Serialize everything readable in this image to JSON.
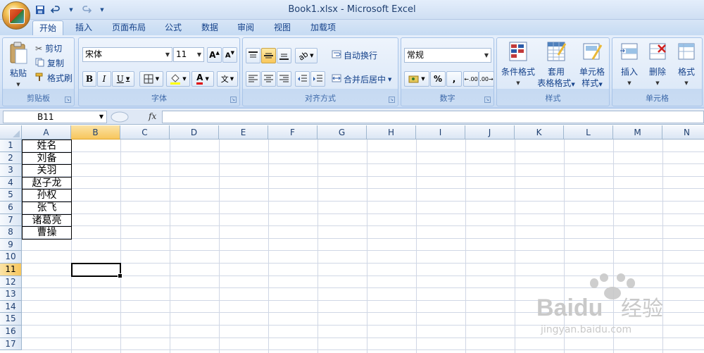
{
  "window": {
    "title": "Book1.xlsx - Microsoft Excel"
  },
  "tabs": [
    "开始",
    "插入",
    "页面布局",
    "公式",
    "数据",
    "审阅",
    "视图",
    "加载项"
  ],
  "active_tab": "开始",
  "clipboard": {
    "paste": "粘贴",
    "cut": "剪切",
    "copy": "复制",
    "format_painter": "格式刷",
    "group": "剪贴板"
  },
  "font": {
    "name": "宋体",
    "size": "11",
    "bold": "B",
    "italic": "I",
    "underline": "U",
    "group": "字体",
    "phonetic": "文"
  },
  "alignment": {
    "wrap": "自动换行",
    "merge": "合并后居中",
    "group": "对齐方式"
  },
  "number": {
    "format": "常规",
    "percent": "%",
    "comma": ",",
    "inc_decimal": ".00",
    "dec_decimal": ".00",
    "group": "数字"
  },
  "styles": {
    "conditional": "条件格式",
    "table_a": "套用",
    "table_b": "表格格式",
    "cell_a": "单元格",
    "cell_b": "样式",
    "group": "样式"
  },
  "cells": {
    "insert": "插入",
    "delete": "删除",
    "format": "格式",
    "group": "单元格"
  },
  "formula_bar": {
    "name_box": "B11",
    "fx": "fx",
    "value": ""
  },
  "columns": [
    "A",
    "B",
    "C",
    "D",
    "E",
    "F",
    "G",
    "H",
    "I",
    "J",
    "K",
    "L",
    "M",
    "N"
  ],
  "selected_column": "B",
  "rows": [
    "1",
    "2",
    "3",
    "4",
    "5",
    "6",
    "7",
    "8",
    "9",
    "10",
    "11",
    "12",
    "13",
    "14",
    "15",
    "16",
    "17"
  ],
  "selected_row": "11",
  "column_a": [
    "姓名",
    "刘备",
    "关羽",
    "赵子龙",
    "孙权",
    "张飞",
    "诸葛亮",
    "曹操"
  ],
  "watermark": {
    "brand": "Baidu",
    "cn": "经验",
    "url": "jingyan.baidu.com"
  },
  "colors": {
    "accent": "#15428b",
    "selection": "#f7c65c",
    "ribbon": "#dbe7f6"
  }
}
